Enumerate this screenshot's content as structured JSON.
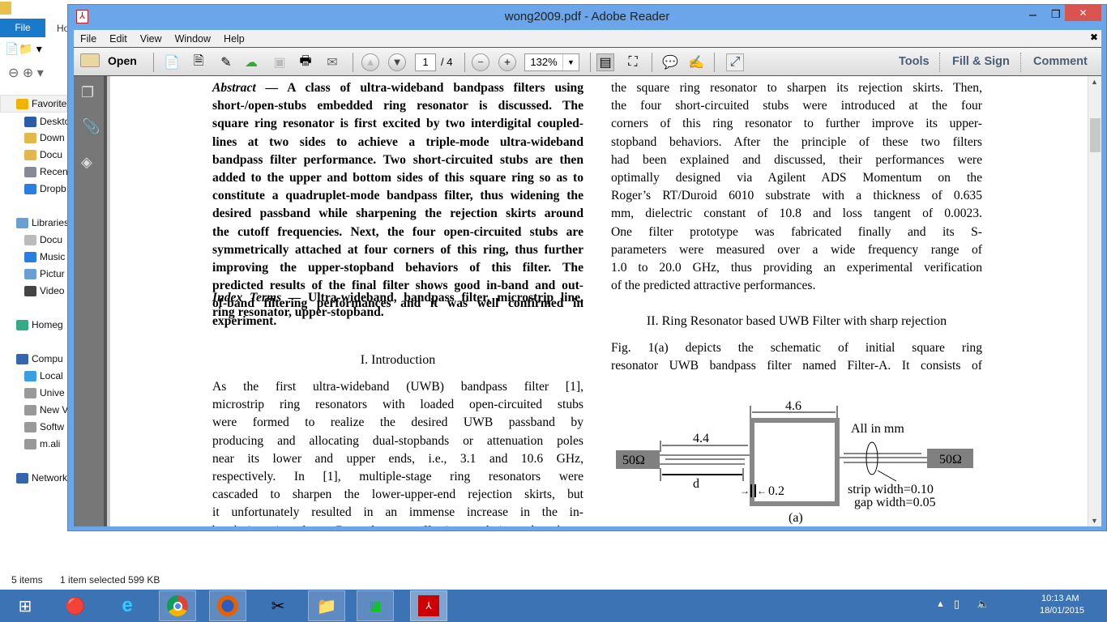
{
  "explorer": {
    "tab_file": "File",
    "tab_home": "Ho",
    "nav": [
      "Favorite",
      "Deskto",
      "Down",
      "Docu",
      "Recen",
      "Dropb",
      "Libraries",
      "Docu",
      "Music",
      "Pictur",
      "Video",
      "Homeg",
      "Compu",
      "Local",
      "Unive",
      "New V",
      "Softw",
      "m.ali",
      "Network"
    ],
    "status_items": "5 items",
    "status_selected": "1 item selected  599 KB"
  },
  "window": {
    "title": "wong2009.pdf - Adobe Reader",
    "menu": [
      "File",
      "Edit",
      "View",
      "Window",
      "Help"
    ],
    "open_label": "Open",
    "page_current": "1",
    "page_total": "/ 4",
    "zoom": "132%",
    "right_tabs": [
      "Tools",
      "Fill & Sign",
      "Comment"
    ]
  },
  "doc": {
    "abstract_label": "Abstract —",
    "abstract_lines": [
      "A class of ultra-wideband bandpass filters using",
      "short-/open-stubs embedded ring resonator is discussed. The",
      "square ring resonator is first excited by two interdigital coupled-",
      "lines at two sides to achieve a triple-mode ultra-wideband",
      "bandpass filter performance. Two short-circuited stubs are then",
      "added to the upper and bottom sides of this square ring so as to",
      "constitute a quadruplet-mode bandpass filter, thus widening the",
      "desired passband while sharpening the rejection skirts around",
      "the cutoff frequencies. Next, the four open-circuited stubs are",
      "symmetrically attached at four corners of this ring, thus further",
      "improving the upper-stopband behaviors of this filter. The",
      "predicted results of the final filter shows good in-band and out-",
      "of-band filtering performances and it was well confirmed in",
      "experiment."
    ],
    "index_label": "Index Terms —",
    "index_lines": [
      "Ultra-wideband, bandpass filter, microstrip line,",
      "ring resonator, upper-stopband."
    ],
    "intro_heading": "I. Introduction",
    "intro_lines": [
      "As the first ultra-wideband (UWB) bandpass filter [1],",
      "microstrip ring resonators with loaded open-circuited stubs",
      "were formed to realize the desired UWB passband by",
      "producing and allocating dual-stopbands or attenuation poles",
      "near its lower and upper ends, i.e., 3.1 and 10.6 GHz,",
      "respectively. In [1], multiple-stage ring resonators were",
      "cascaded to sharpen the lower-upper-end rejection skirts, but",
      "it unfortunately resulted in an immense increase in the in-",
      "band insertion loss. Recently, an effective technique based on"
    ],
    "right_lines": [
      "the square ring resonator to sharpen its rejection skirts. Then,",
      "the four short-circuited stubs were introduced at the four",
      "corners of this ring resonator to further improve its upper-",
      "stopband behaviors.  After the principle of these two filters",
      "had been explained and discussed, their performances were",
      "optimally designed via Agilent ADS Momentum on the",
      "Roger’s RT/Duroid 6010 substrate with a thickness of 0.635",
      "mm, dielectric constant of 10.8 and loss tangent of 0.0023.",
      "One filter prototype was fabricated finally and its S-",
      "parameters were measured over a wide frequency range of",
      "1.0 to 20.0 GHz, thus providing an experimental verification",
      "of the predicted attractive performances."
    ],
    "section2_heading": "II. Ring Resonator based UWB Filter with sharp rejection",
    "section2_lines": [
      "Fig. 1(a) depicts the schematic of initial square ring",
      "resonator UWB bandpass filter named Filter-A. It consists of"
    ],
    "figure": {
      "port_left": "50Ω",
      "port_right": "50Ω",
      "dim_ring": "4.6",
      "dim_coupled": "4.4",
      "dim_d": "d",
      "dim_width": "0.2",
      "units": "All in mm",
      "strip": "strip width=0.10",
      "gap": "gap width=0.05",
      "caption": "(a)"
    }
  },
  "taskbar": {
    "time": "10:13 AM",
    "date": "18/01/2015"
  }
}
